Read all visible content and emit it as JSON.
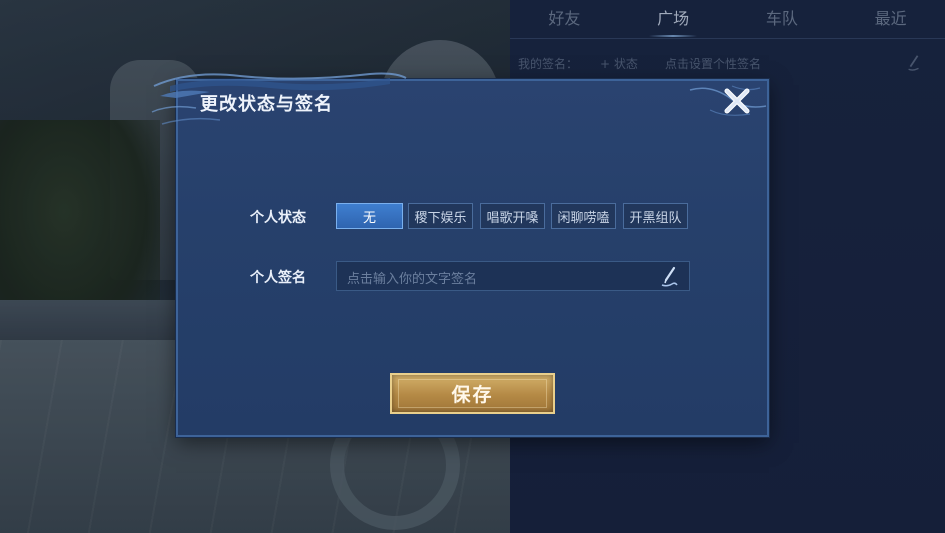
{
  "right_panel": {
    "tabs": [
      "好友",
      "广场",
      "车队",
      "最近"
    ],
    "active_tab": "广场",
    "signature_row": {
      "label": "我的签名：",
      "status_button": "+ 状态",
      "placeholder": "点击设置个性签名"
    }
  },
  "modal": {
    "title": "更改状态与签名",
    "status_label": "个人状态",
    "status_options": [
      "无",
      "稷下娱乐",
      "唱歌开嗓",
      "闲聊唠嗑",
      "开黑组队"
    ],
    "selected_status": "无",
    "signature_label": "个人签名",
    "signature_placeholder": "点击输入你的文字签名",
    "signature_value": "",
    "save_label": "保存"
  },
  "colors": {
    "accent_blue": "#3f7fd0",
    "gold_button": "#c59d58",
    "modal_bg": "#26406b"
  },
  "icons": [
    "close-icon",
    "pen-icon"
  ]
}
